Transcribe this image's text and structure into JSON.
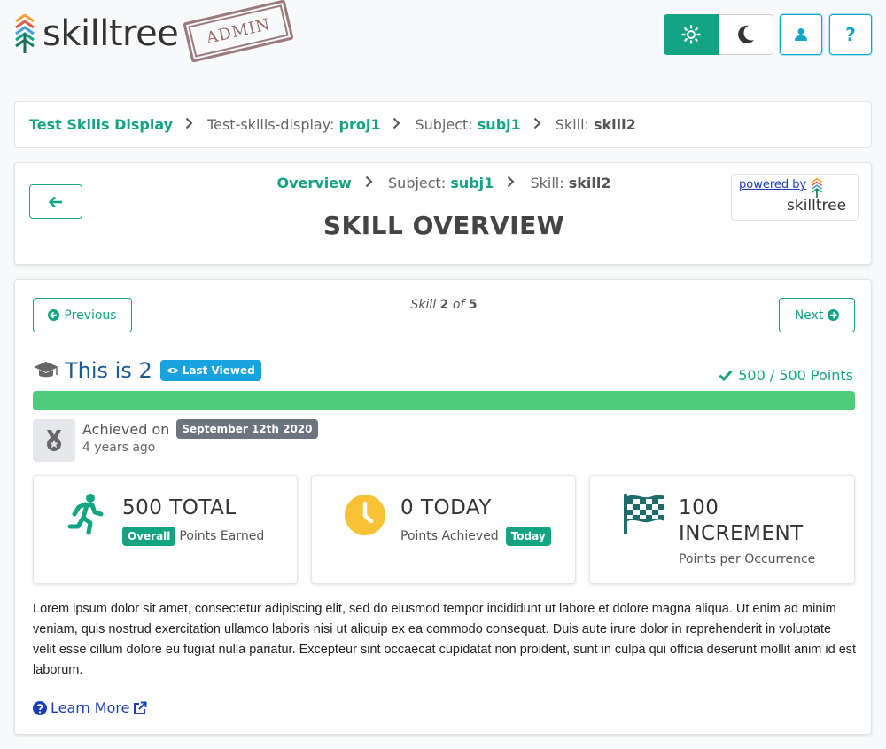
{
  "header": {
    "logo_text": "skilltree",
    "stamp_text": "ADMIN",
    "theme_light_icon": "sun-icon",
    "theme_dark_icon": "moon-icon",
    "user_icon": "user-icon",
    "help_label": "?",
    "colors": {
      "primary": "#13a583",
      "info": "#13a5c8"
    }
  },
  "breadcrumb": {
    "root": "Test Skills Display",
    "project_label": "Test-skills-display:",
    "project_value": "proj1",
    "subject_label": "Subject:",
    "subject_value": "subj1",
    "skill_label": "Skill:",
    "skill_value": "skill2"
  },
  "overview": {
    "crumb_overview": "Overview",
    "subject_label": "Subject:",
    "subject_value": "subj1",
    "skill_label": "Skill:",
    "skill_value": "skill2",
    "title": "SKILL OVERVIEW",
    "powered_by": "powered by",
    "powered_logo": "skilltree"
  },
  "skill": {
    "prev_label": "Previous",
    "next_label": "Next",
    "count_prefix": "Skill",
    "count_current": "2",
    "count_of": "of",
    "count_total": "5",
    "title": "This is 2",
    "last_viewed": "Last Viewed",
    "points": "500 / 500 Points",
    "progress_percent": 100,
    "achieved_label": "Achieved on",
    "achieved_date": "September 12th 2020",
    "achieved_ago": "4 years ago",
    "stats": [
      {
        "big": "500 TOTAL",
        "badge": "Overall",
        "sub": "Points Earned"
      },
      {
        "big": "0 TODAY",
        "sub": "Points Achieved",
        "badge": "Today"
      },
      {
        "big": "100 INCREMENT",
        "sub": "Points per Occurrence"
      }
    ],
    "description": "Lorem ipsum dolor sit amet, consectetur adipiscing elit, sed do eiusmod tempor incididunt ut labore et dolore magna aliqua. Ut enim ad minim veniam, quis nostrud exercitation ullamco laboris nisi ut aliquip ex ea commodo consequat. Duis aute irure dolor in reprehenderit in voluptate velit esse cillum dolore eu fugiat nulla pariatur. Excepteur sint occaecat cupidatat non proident, sunt in culpa qui officia deserunt mollit anim id est laborum.",
    "learn_more": "Learn More"
  }
}
